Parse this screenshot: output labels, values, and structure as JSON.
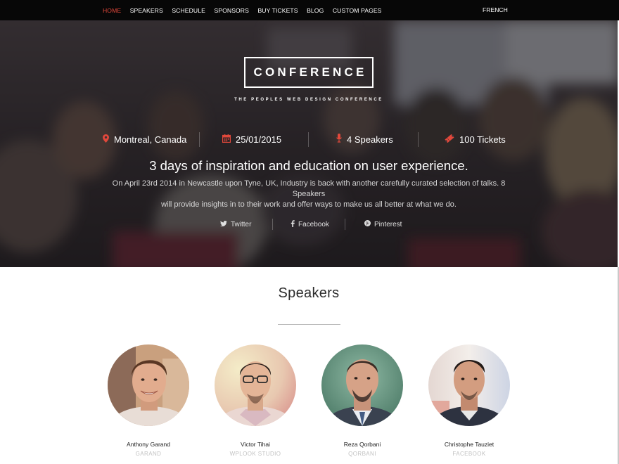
{
  "nav": {
    "items": [
      {
        "label": "HOME",
        "active": true
      },
      {
        "label": "SPEAKERS",
        "active": false
      },
      {
        "label": "SCHEDULE",
        "active": false
      },
      {
        "label": "SPONSORS",
        "active": false
      },
      {
        "label": "BUY TICKETS",
        "active": false
      },
      {
        "label": "BLOG",
        "active": false
      },
      {
        "label": "CUSTOM PAGES",
        "active": false
      }
    ],
    "language": "FRENCH",
    "active_color": "#e2483b"
  },
  "hero": {
    "logo": "CONFERENCE",
    "tagline": "THE PEOPLES WEB DESIGN CONFERENCE",
    "facts": [
      {
        "icon": "map-pin-icon",
        "text": "Montreal, Canada"
      },
      {
        "icon": "calendar-icon",
        "text": "25/01/2015"
      },
      {
        "icon": "microphone-icon",
        "text": "4 Speakers"
      },
      {
        "icon": "ticket-icon",
        "text": "100 Tickets"
      }
    ],
    "icon_color": "#e2483b",
    "headline": "3 days of inspiration and education on user experience.",
    "description_line1": "On April 23rd 2014 in Newcastle upon Tyne, UK, Industry is back with another carefully curated selection of talks. 8 Speakers",
    "description_line2": "will provide insights in to their work and offer ways to make us all better at what we do.",
    "social": [
      {
        "icon": "twitter-icon",
        "label": "Twitter"
      },
      {
        "icon": "facebook-icon",
        "label": "Facebook"
      },
      {
        "icon": "pinterest-icon",
        "label": "Pinterest"
      }
    ]
  },
  "speakers_section": {
    "title": "Speakers",
    "speakers": [
      {
        "name": "Anthony Garand",
        "org": "GARAND"
      },
      {
        "name": "Victor Tihai",
        "org": "WPLOOK STUDIO"
      },
      {
        "name": "Reza Qorbani",
        "org": "QORBANI"
      },
      {
        "name": "Christophe Tauziet",
        "org": "FACEBOOK"
      }
    ]
  }
}
